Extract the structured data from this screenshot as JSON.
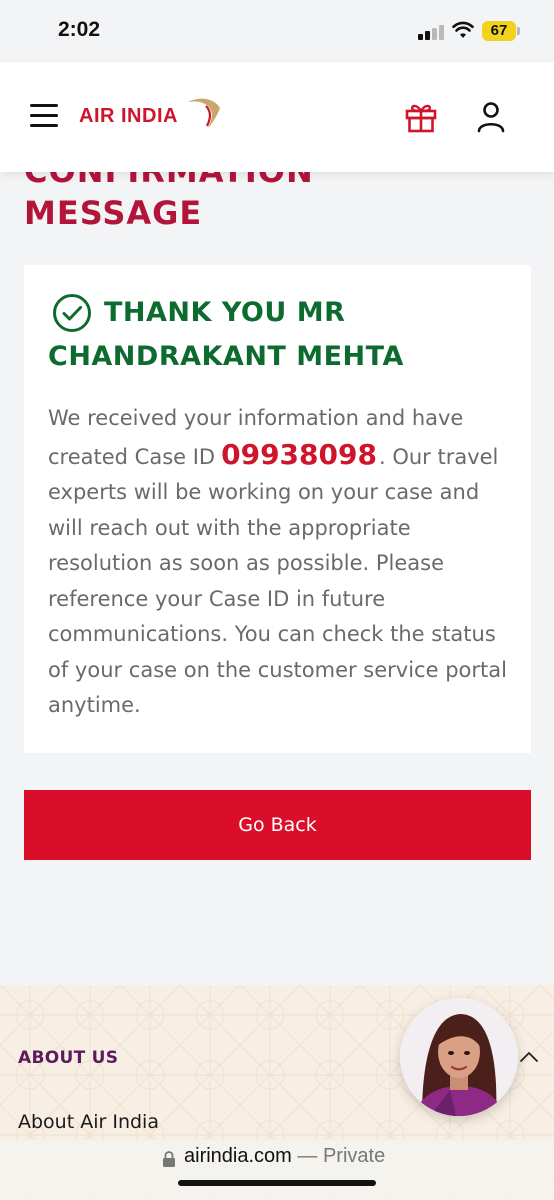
{
  "status_bar": {
    "time": "2:02",
    "battery": "67",
    "icons": [
      "signal-icon",
      "wifi-icon",
      "battery-icon"
    ]
  },
  "header": {
    "logo_text": "AIR INDIA",
    "icons": [
      "hamburger-menu-icon",
      "air-india-swoosh-logo",
      "gift-icon",
      "user-icon"
    ]
  },
  "main": {
    "title_line_hidden": "CONFIRMATION",
    "title_line": "MESSAGE",
    "thanks_line1": "THANK YOU MR",
    "thanks_line2": "CHANDRAKANT MEHTA",
    "message_before_id": "We received your information and have created Case ID",
    "case_id": "09938098",
    "message_after_id": ". Our travel experts will be working on your case and will reach out with the appropriate resolution as soon as possible. Please reference your Case ID in future communications. You can check the status of your case on the customer service portal anytime.",
    "go_back_label": "Go Back"
  },
  "footer": {
    "about_heading": "ABOUT US",
    "about_link": "About Air India"
  },
  "browser": {
    "url": "airindia.com",
    "mode": " — Private"
  },
  "colors": {
    "brand_red": "#da0e2b",
    "title_red": "#b3143a",
    "success_green": "#0e6b2f",
    "about_purple": "#5c1b5e",
    "footer_cream": "#f8efe4"
  }
}
